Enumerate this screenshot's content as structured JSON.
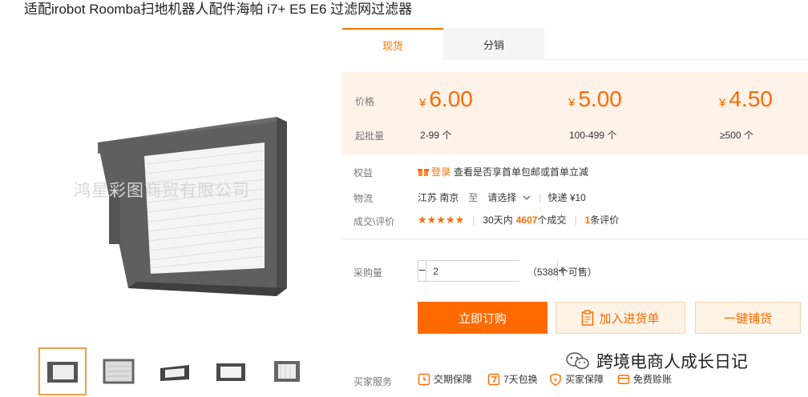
{
  "product": {
    "title": "适配irobot Roomba扫地机器人配件海帕 i7+ E5 E6 过滤网过滤器",
    "image_watermark": "鸿星彩图商贸有限公司"
  },
  "tabs": [
    {
      "label": "现货",
      "active": true
    },
    {
      "label": "分销",
      "active": false
    }
  ],
  "pricing": {
    "price_label": "价格",
    "qty_label": "起批量",
    "currency": "¥",
    "tiers": [
      {
        "price": "6.00",
        "range": "2-99 个"
      },
      {
        "price": "5.00",
        "range": "100-499 个"
      },
      {
        "price": "4.50",
        "range": "≥500 个"
      }
    ]
  },
  "benefits": {
    "label": "权益",
    "login": "登录",
    "text": "查看是否享首单包邮或首单立减"
  },
  "logistics": {
    "label": "物流",
    "origin": "江苏 南京",
    "to": "至",
    "destination": "请选择",
    "shipping": "快递 ¥10"
  },
  "reviews": {
    "label": "成交\\评价",
    "stars": "★★★★★",
    "sales_prefix": "30天内",
    "sales_count": "4607",
    "sales_suffix": "个成交",
    "review_count": "1",
    "review_suffix": "条评价"
  },
  "purchase": {
    "label": "采购量",
    "minus": "−",
    "plus": "+",
    "quantity": "2",
    "available": "（5388个可售）"
  },
  "actions": {
    "buy_now": "立即订购",
    "add_to_list": "加入进货单",
    "one_click": "一键铺货"
  },
  "services": {
    "label": "买家服务",
    "items": [
      {
        "label": "交期保障",
        "icon": "clock-shield-icon"
      },
      {
        "label": "7天包换",
        "icon": "seven-day-icon"
      },
      {
        "label": "买家保障",
        "icon": "shield-icon"
      },
      {
        "label": "免费赊账",
        "icon": "credit-icon"
      }
    ]
  },
  "brand_watermark": "跨境电商人成长日记",
  "colors": {
    "accent": "#ff6a00",
    "price_bg": "#fff2e8"
  }
}
